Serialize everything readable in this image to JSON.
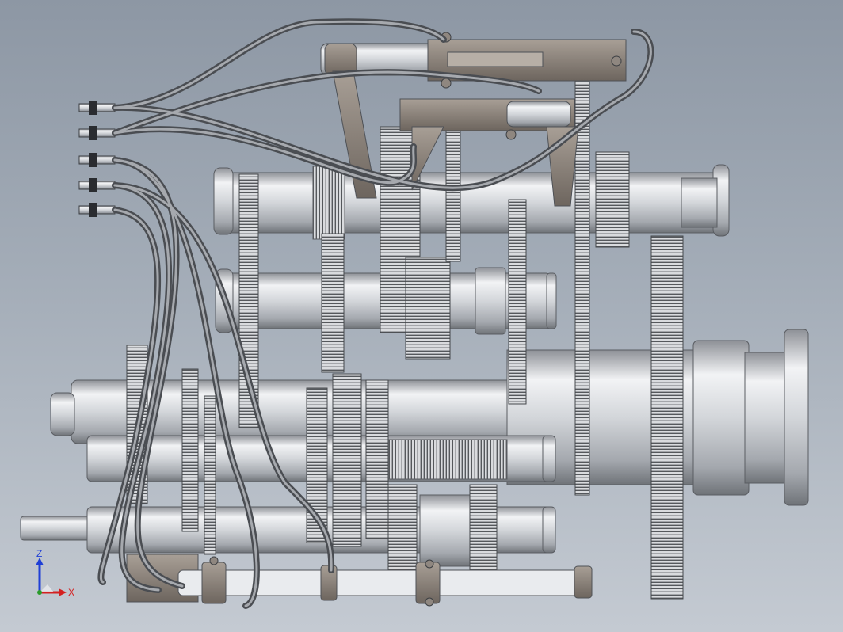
{
  "viewport": {
    "background_top": "#8d97a4",
    "background_bottom": "#c4cad2"
  },
  "triad": {
    "z_label": "Z",
    "x_label": "X",
    "z_color": "#1f3fd6",
    "x_color": "#d42020",
    "y_color": "#2a9c2a"
  },
  "model": {
    "metal_color": "#c9ccd1",
    "bracket_color": "#8a8077",
    "hose_color": "#6f7276"
  }
}
